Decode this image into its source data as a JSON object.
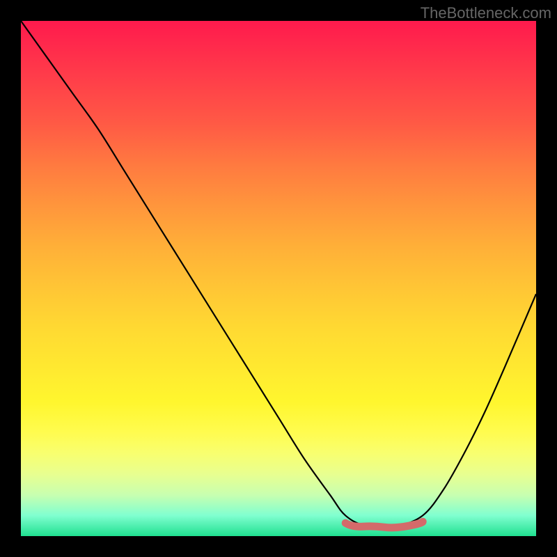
{
  "watermark": "TheBottleneck.com",
  "chart_data": {
    "type": "line",
    "title": "",
    "xlabel": "",
    "ylabel": "",
    "xlim": [
      0,
      100
    ],
    "ylim": [
      0,
      100
    ],
    "series": [
      {
        "name": "curve",
        "x": [
          0,
          5,
          10,
          15,
          20,
          25,
          30,
          35,
          40,
          45,
          50,
          55,
          60,
          63,
          67,
          73,
          78,
          82,
          86,
          90,
          94,
          100
        ],
        "values": [
          100,
          93,
          86,
          79,
          71,
          63,
          55,
          47,
          39,
          31,
          23,
          15,
          8,
          4,
          2,
          2,
          4,
          9,
          16,
          24,
          33,
          47
        ]
      }
    ],
    "flat_region": {
      "x_start": 63,
      "x_end": 78,
      "y": 2
    },
    "colors": {
      "background": "#000000",
      "gradient_top": "#ff1a4d",
      "gradient_mid": "#ffda32",
      "gradient_bottom": "#20e090",
      "curve": "#000000",
      "flat_marker": "#d46a6a",
      "watermark": "#666666"
    }
  }
}
